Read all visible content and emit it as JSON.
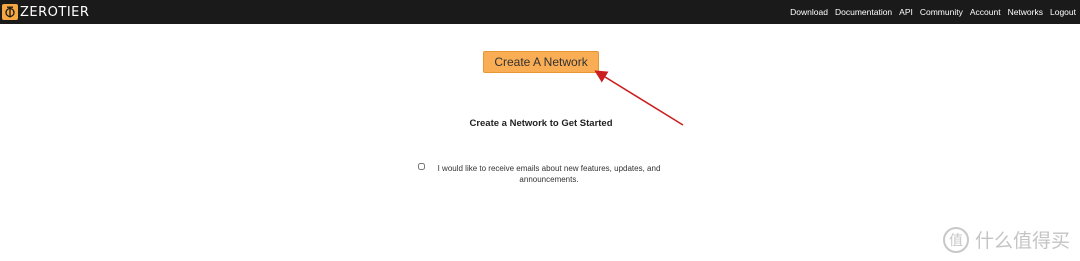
{
  "header": {
    "logo_text": "ZEROTIER",
    "nav": [
      "Download",
      "Documentation",
      "API",
      "Community",
      "Account",
      "Networks",
      "Logout"
    ]
  },
  "main": {
    "create_button_label": "Create A Network",
    "heading": "Create a Network to Get Started",
    "optin_label": "I would like to receive emails about new features, updates, and announcements.",
    "optin_checked": false
  },
  "watermark": {
    "text": "什么值得买",
    "glyph": "值"
  },
  "colors": {
    "topbar": "#1a1a1a",
    "brand": "#f5a742",
    "button": "#f9ad55",
    "arrow": "#cc1f1f"
  },
  "icons": {
    "logo": "zerotier-logo-icon",
    "arrow": "annotation-arrow-icon",
    "watermark": "smzdm-logo-icon"
  }
}
